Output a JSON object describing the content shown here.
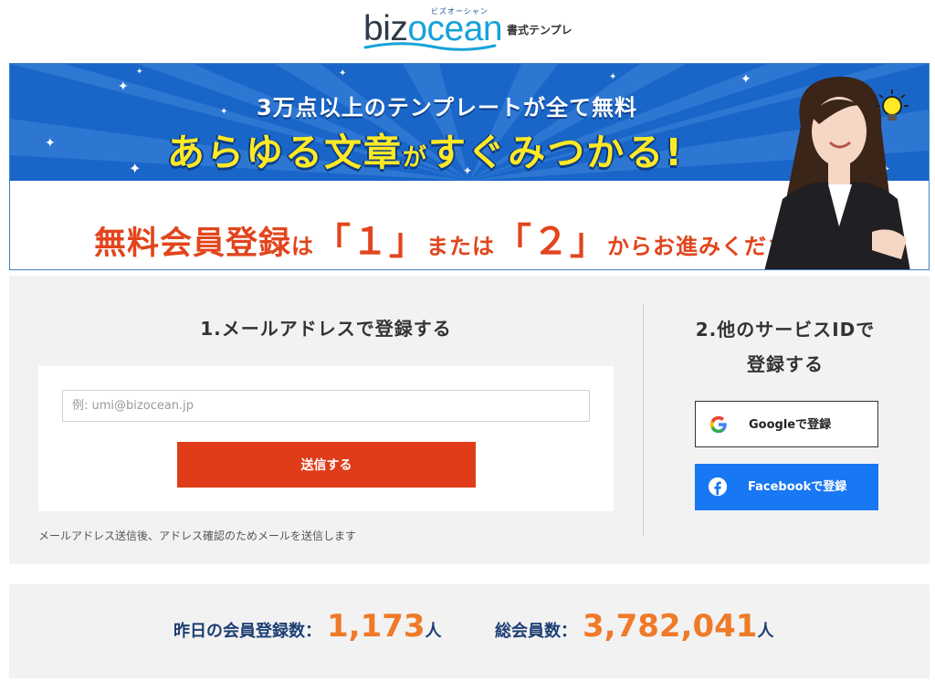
{
  "header": {
    "logo_kana": "ビズオーシャン",
    "logo_text_a": "biz",
    "logo_text_b": "ocean",
    "subtitle": "書式テンプレ"
  },
  "banner": {
    "line1": "3万点以上のテンプレートが全て無料",
    "line2_a": "あらゆる文章",
    "line2_b": "が",
    "line2_c": "すぐみつかる!",
    "line3_a": "無料会員登録",
    "line3_b": "は",
    "line3_c": "「１」",
    "line3_d": "または",
    "line3_e": "「２」",
    "line3_f": "からお進みください"
  },
  "register": {
    "email_title": "1.メールアドレスで登録する",
    "email_placeholder": "例: umi@bizocean.jp",
    "submit_label": "送信する",
    "note": "メールアドレス送信後、アドレス確認のためメールを送信します",
    "other_title_line1": "2.他のサービスIDで",
    "other_title_line2": "登録する",
    "google_label": "Googleで登録",
    "facebook_label": "Facebookで登録"
  },
  "stats": {
    "yesterday_label": "昨日の会員登録数：",
    "yesterday_value": "1,173",
    "yesterday_unit": "人",
    "total_label": "総会員数：",
    "total_value": "3,782,041",
    "total_unit": "人"
  },
  "colors": {
    "primary_button": "#e03c1a",
    "facebook_blue": "#1877f2",
    "stat_value": "#ef7a28",
    "stat_label": "#1c3f73",
    "banner_blue": "#1a66c8",
    "banner_yellow": "#ffe926"
  },
  "icons": [
    "google-icon",
    "facebook-icon",
    "lightbulb-icon",
    "sparkle-icon"
  ]
}
